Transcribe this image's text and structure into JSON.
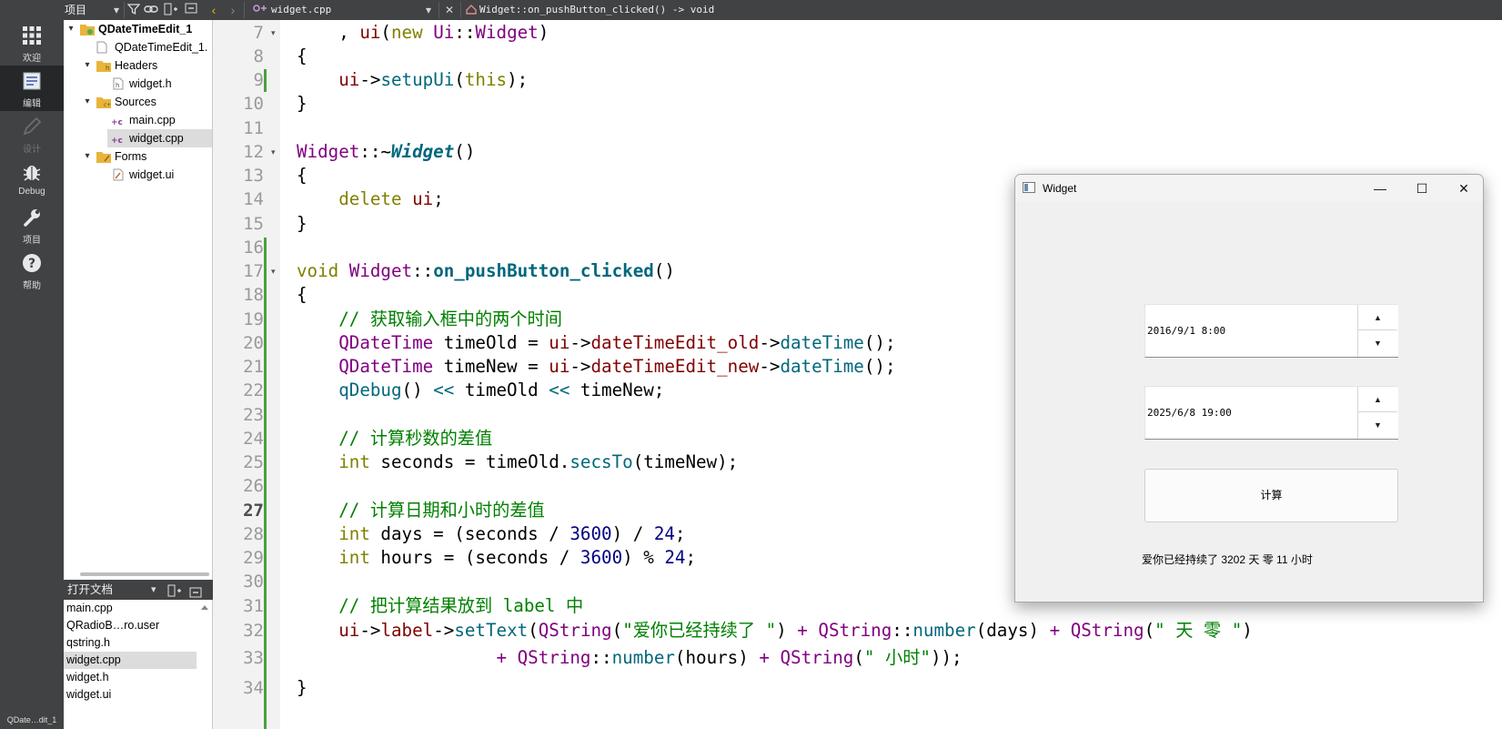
{
  "topbar": {
    "project_dropdown": "项目",
    "file_tab": "widget.cpp",
    "symbol_path": "Widget::on_pushButton_clicked() -> void"
  },
  "modes": [
    {
      "label": "欢迎",
      "icon": "grid-icon"
    },
    {
      "label": "编辑",
      "icon": "edit-doc-icon"
    },
    {
      "label": "设计",
      "icon": "pencil-icon"
    },
    {
      "label": "Debug",
      "icon": "bug-icon"
    },
    {
      "label": "项目",
      "icon": "wrench-icon"
    },
    {
      "label": "帮助",
      "icon": "help-icon"
    }
  ],
  "mode_status": "QDate…dit_1",
  "tree": {
    "project": "QDateTimeEdit_1",
    "pro_file": "QDateTimeEdit_1.",
    "headers_folder": "Headers",
    "header_file": "widget.h",
    "sources_folder": "Sources",
    "source_main": "main.cpp",
    "source_widget": "widget.cpp",
    "forms_folder": "Forms",
    "form_file": "widget.ui"
  },
  "open_docs": {
    "title": "打开文档",
    "items": [
      "main.cpp",
      "QRadioB…ro.user",
      "qstring.h",
      "widget.cpp",
      "widget.h",
      "widget.ui"
    ]
  },
  "line_numbers": [
    "7",
    "8",
    "9",
    "10",
    "11",
    "12",
    "13",
    "14",
    "15",
    "16",
    "17",
    "18",
    "19",
    "20",
    "21",
    "22",
    "23",
    "24",
    "25",
    "26",
    "27",
    "28",
    "29",
    "30",
    "31",
    "32",
    "33",
    "34"
  ],
  "code": {
    "l7a": "    , ",
    "l7b": "ui",
    "l7c": "(",
    "l7d": "new",
    "l7e": " ",
    "l7f": "Ui",
    "l7g": "::",
    "l7h": "Widget",
    "l7i": ")",
    "l8": "{",
    "l9a": "    ",
    "l9b": "ui",
    "l9c": "->",
    "l9d": "setupUi",
    "l9e": "(",
    "l9f": "this",
    "l9g": ");",
    "l10": "}",
    "l12a": "Widget",
    "l12b": "::~",
    "l12c": "Widget",
    "l12d": "()",
    "l13": "{",
    "l14a": "    ",
    "l14b": "delete",
    "l14c": " ",
    "l14d": "ui",
    "l14e": ";",
    "l15": "}",
    "l17a": "void",
    "l17b": " ",
    "l17c": "Widget",
    "l17d": "::",
    "l17e": "on_pushButton_clicked",
    "l17f": "()",
    "l18": "{",
    "l19": "    // 获取输入框中的两个时间",
    "l20a": "    ",
    "l20b": "QDateTime",
    "l20c": " timeOld = ",
    "l20d": "ui",
    "l20e": "->",
    "l20f": "dateTimeEdit_old",
    "l20g": "->",
    "l20h": "dateTime",
    "l20i": "();",
    "l21a": "    ",
    "l21b": "QDateTime",
    "l21c": " timeNew = ",
    "l21d": "ui",
    "l21e": "->",
    "l21f": "dateTimeEdit_new",
    "l21g": "->",
    "l21h": "dateTime",
    "l21i": "();",
    "l22a": "    ",
    "l22b": "qDebug",
    "l22c": "() ",
    "l22d": "<<",
    "l22e": " timeOld ",
    "l22f": "<<",
    "l22g": " timeNew;",
    "l24": "    // 计算秒数的差值",
    "l25a": "    ",
    "l25b": "int",
    "l25c": " seconds = timeOld.",
    "l25d": "secsTo",
    "l25e": "(timeNew);",
    "l27": "    // 计算日期和小时的差值",
    "l28a": "    ",
    "l28b": "int",
    "l28c": " days = (seconds / ",
    "l28d": "3600",
    "l28e": ") / ",
    "l28f": "24",
    "l28g": ";",
    "l29a": "    ",
    "l29b": "int",
    "l29c": " hours = (seconds / ",
    "l29d": "3600",
    "l29e": ") % ",
    "l29f": "24",
    "l29g": ";",
    "l31": "    // 把计算结果放到 label 中",
    "l32a": "    ",
    "l32b": "ui",
    "l32c": "->",
    "l32d": "label",
    "l32e": "->",
    "l32f": "setText",
    "l32g": "(",
    "l32h": "QString",
    "l32i": "(",
    "l32j": "\"爱你已经持续了 \"",
    "l32k": ") ",
    "l32l": "+",
    "l32m": " ",
    "l32n": "QString",
    "l32o": "::",
    "l32p": "number",
    "l32q": "(days) ",
    "l32r": "+",
    "l32s": " ",
    "l32t": "QString",
    "l32u": "(",
    "l32v": "\" 天 零 \"",
    "l32w": ")",
    "l33a": "                   ",
    "l33b": "+",
    "l33c": " ",
    "l33d": "QString",
    "l33e": "::",
    "l33f": "number",
    "l33g": "(hours) ",
    "l33h": "+",
    "l33i": " ",
    "l33j": "QString",
    "l33k": "(",
    "l33l": "\" 小时\"",
    "l33m": "));",
    "l34": "}"
  },
  "widget_window": {
    "title": "Widget",
    "minimize": "—",
    "maximize": "☐",
    "close": "✕",
    "date_old": "2016/9/1 8:00",
    "date_new": "2025/6/8 19:00",
    "calc_button": "计算",
    "result": "爱你已经持续了 3202 天 零 11 小时"
  }
}
